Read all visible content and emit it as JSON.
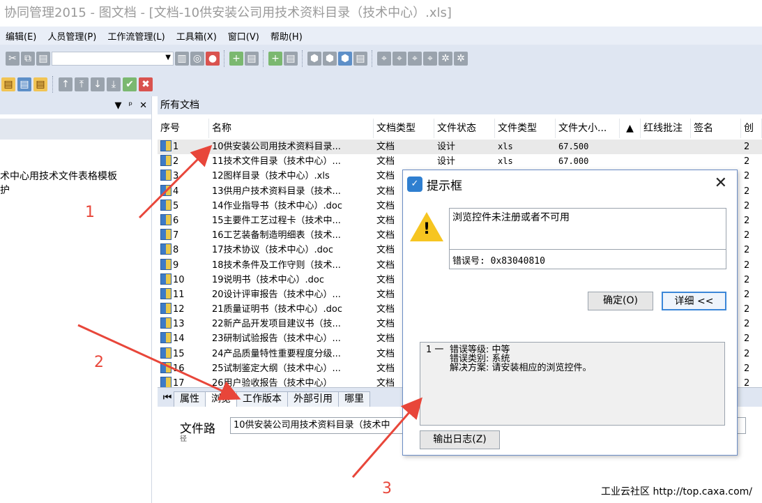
{
  "window_title": "协同管理2015 - 图文档 - [文档-10供安装公司用技术资料目录（技术中心）.xls]",
  "menu": [
    "编辑(E)",
    "人员管理(P)",
    "工作流管理(L)",
    "工具箱(X)",
    "窗口(V)",
    "帮助(H)"
  ],
  "left_pane": {
    "header_controls": [
      "▼",
      "ᵖ",
      "✕"
    ],
    "tree_item_1": "术中心用技术文件表格模板",
    "tree_item_2": "护"
  },
  "doc_panel": {
    "title": "所有文档",
    "columns": [
      "序号",
      "名称",
      "文档类型",
      "文件状态",
      "文件类型",
      "文件大小...",
      "红线批注",
      "签名",
      "创"
    ],
    "sort_indicator": "▲",
    "rows": [
      {
        "seq": "1",
        "name": "10供安装公司用技术资料目录...",
        "doctype": "文档",
        "status": "设计",
        "ftype": "xls",
        "size": "67.500",
        "extra": "2"
      },
      {
        "seq": "2",
        "name": "11技术文件目录（技术中心）...",
        "doctype": "文档",
        "status": "设计",
        "ftype": "xls",
        "size": "67.000",
        "extra": "2"
      },
      {
        "seq": "3",
        "name": "12图样目录（技术中心）.xls",
        "doctype": "文档",
        "status": "",
        "ftype": "",
        "size": "",
        "extra": "2"
      },
      {
        "seq": "4",
        "name": "13供用户技术资料目录（技术...",
        "doctype": "文档",
        "status": "",
        "ftype": "",
        "size": "",
        "extra": "2"
      },
      {
        "seq": "5",
        "name": "14作业指导书（技术中心）.doc",
        "doctype": "文档",
        "status": "",
        "ftype": "",
        "size": "",
        "extra": "2"
      },
      {
        "seq": "6",
        "name": "15主要件工艺过程卡（技术中...",
        "doctype": "文档",
        "status": "",
        "ftype": "",
        "size": "",
        "extra": "2"
      },
      {
        "seq": "7",
        "name": "16工艺装备制造明细表（技术...",
        "doctype": "文档",
        "status": "",
        "ftype": "",
        "size": "",
        "extra": "2"
      },
      {
        "seq": "8",
        "name": "17技术协议（技术中心）.doc",
        "doctype": "文档",
        "status": "",
        "ftype": "",
        "size": "",
        "extra": "2"
      },
      {
        "seq": "9",
        "name": "18技术条件及工作守则（技术...",
        "doctype": "文档",
        "status": "",
        "ftype": "",
        "size": "",
        "extra": "2"
      },
      {
        "seq": "10",
        "name": "19说明书（技术中心）.doc",
        "doctype": "文档",
        "status": "",
        "ftype": "",
        "size": "",
        "extra": "2"
      },
      {
        "seq": "11",
        "name": "20设计评审报告（技术中心）...",
        "doctype": "文档",
        "status": "",
        "ftype": "",
        "size": "",
        "extra": "2"
      },
      {
        "seq": "12",
        "name": "21质量证明书（技术中心）.doc",
        "doctype": "文档",
        "status": "",
        "ftype": "",
        "size": "",
        "extra": "2"
      },
      {
        "seq": "13",
        "name": "22新产品开发项目建议书（技...",
        "doctype": "文档",
        "status": "",
        "ftype": "",
        "size": "",
        "extra": "2"
      },
      {
        "seq": "14",
        "name": "23研制试验报告（技术中心）...",
        "doctype": "文档",
        "status": "",
        "ftype": "",
        "size": "",
        "extra": "2"
      },
      {
        "seq": "15",
        "name": "24产品质量特性重要程度分级...",
        "doctype": "文档",
        "status": "",
        "ftype": "",
        "size": "",
        "extra": "2"
      },
      {
        "seq": "16",
        "name": "25试制鉴定大纲（技术中心）...",
        "doctype": "文档",
        "status": "",
        "ftype": "",
        "size": "",
        "extra": "2"
      },
      {
        "seq": "17",
        "name": "26用户验收报告（技术中心）",
        "doctype": "文档",
        "status": "",
        "ftype": "",
        "size": "",
        "extra": "2"
      }
    ]
  },
  "bottom_tabs": [
    "属性",
    "浏览",
    "工作版本",
    "外部引用",
    "哪里"
  ],
  "active_tab": "浏览",
  "file_path": {
    "label": "文件路",
    "sublabel": "径",
    "value": "10供安装公司用技术资料目录（技术中"
  },
  "dialog": {
    "title": "提示框",
    "message": "浏览控件未注册或者不可用",
    "error_code": "错误号: 0x83040810",
    "ok_button": "确定(O)",
    "details_button": "详细 <<",
    "log_index": "1 一",
    "log_lines": [
      "错误等级: 中等",
      "错误类别: 系统",
      "解决方案: 请安装相应的浏览控件。"
    ],
    "export_button": "输出日志(Z)"
  },
  "annotations": [
    "1",
    "2",
    "3"
  ],
  "annotation_color": "#e8463a",
  "watermark": "工业云社区 http://top.caxa.com/"
}
